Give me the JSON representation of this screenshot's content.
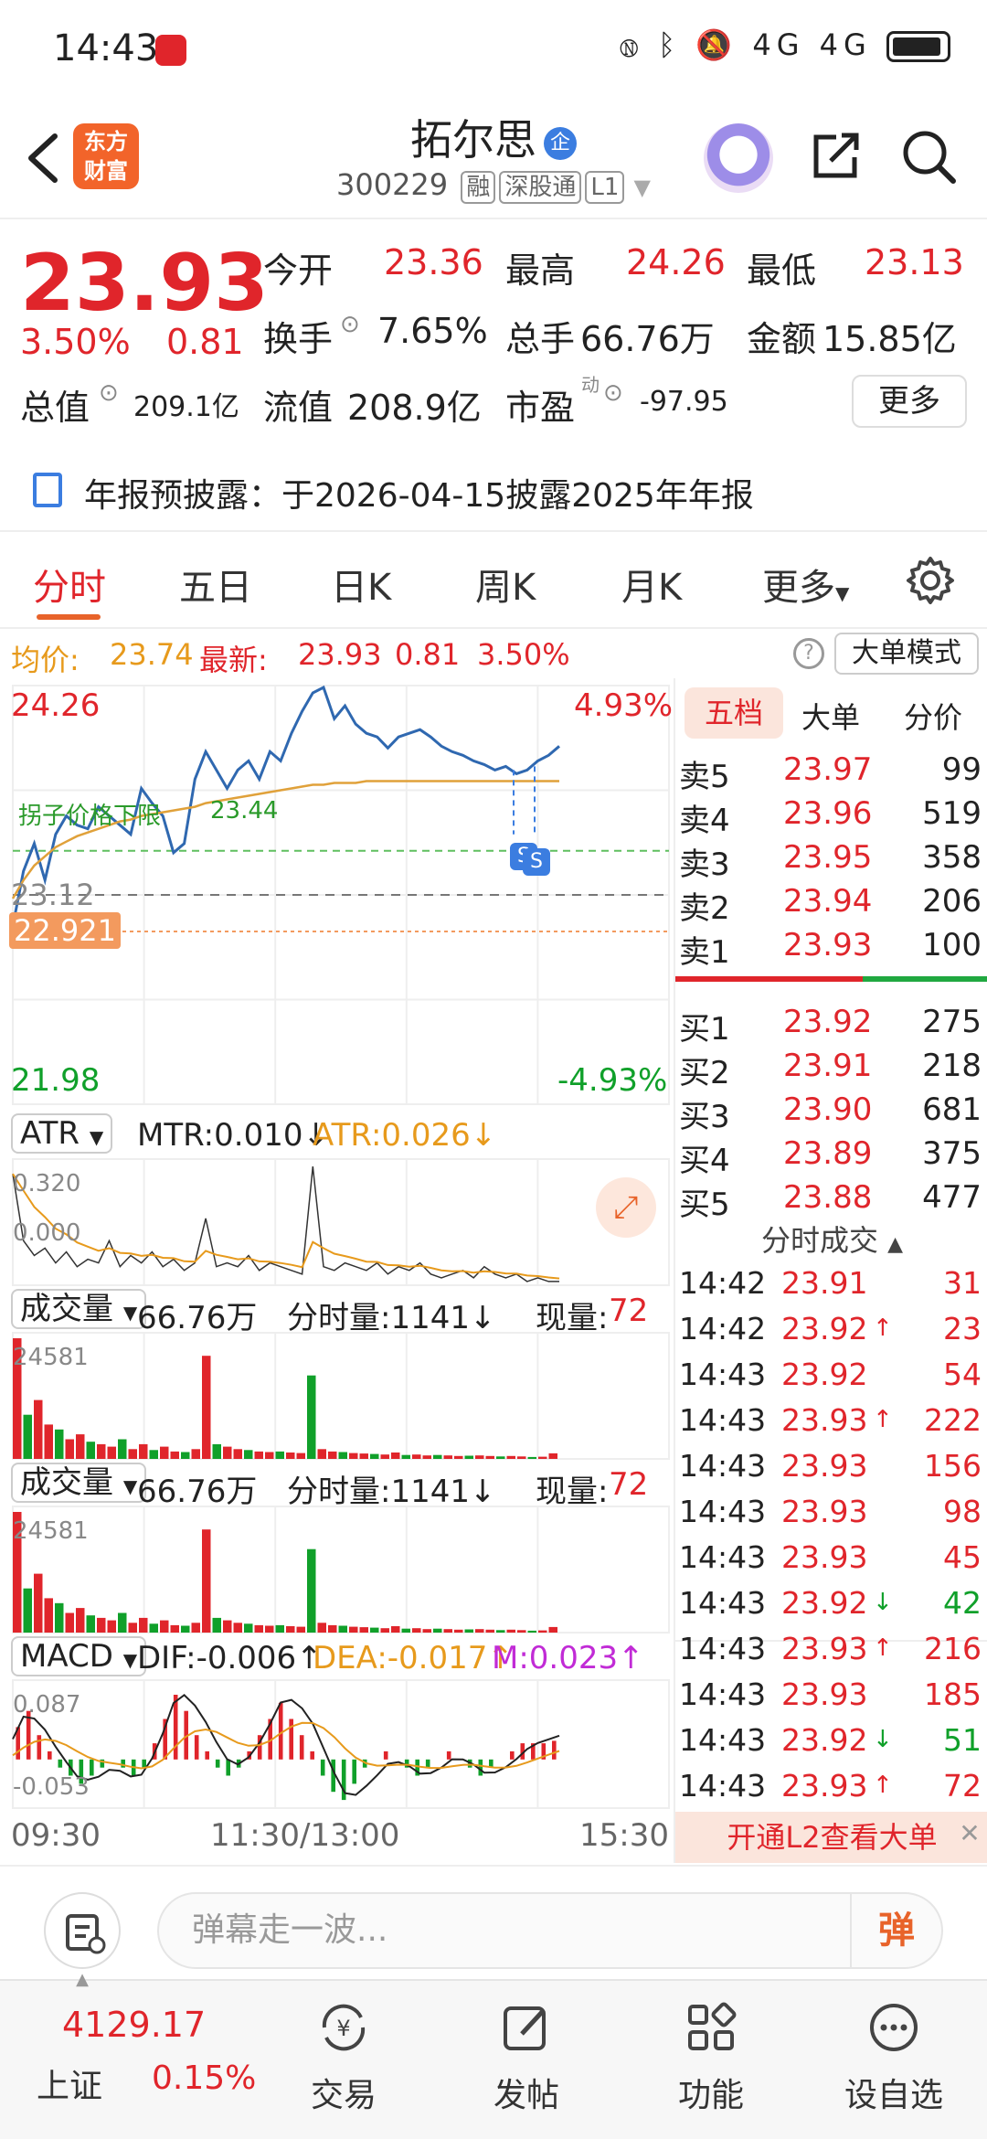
{
  "status_bar": {
    "time": "14:43",
    "network": "4G 4G"
  },
  "header": {
    "logo_line1": "东方",
    "logo_line2": "财富",
    "stock_name": "拓尔思",
    "name_badge": "企",
    "stock_code": "300229",
    "tags": [
      "融",
      "深股通",
      "L1"
    ]
  },
  "quote": {
    "price": "23.93",
    "change_pct": "3.50%",
    "change": "0.81",
    "open_label": "今开",
    "open": "23.36",
    "high_label": "最高",
    "high": "24.26",
    "low_label": "最低",
    "low": "23.13",
    "turnover_label": "换手",
    "turnover": "7.65%",
    "volume_label": "总手",
    "volume": "66.76万",
    "amount_label": "金额",
    "amount": "15.85亿",
    "mcap_label": "总值",
    "mcap": "209.1亿",
    "float_label": "流值",
    "float_mcap": "208.9亿",
    "pe_label": "市盈",
    "pe_sup": "动",
    "pe": "-97.95",
    "more_label": "更多"
  },
  "notice": {
    "text": "年报预披露：于2026-04-15披露2025年年报"
  },
  "tabs": [
    "分时",
    "五日",
    "日K",
    "周K",
    "月K",
    "更多"
  ],
  "info_line": {
    "avg_label": "均价:",
    "avg": "23.74",
    "latest_label": "最新:",
    "latest": "23.93",
    "change": "0.81",
    "change_pct": "3.50%",
    "help": "?",
    "big_order_mode": "大单模式"
  },
  "chart_data": [
    {
      "type": "line",
      "title": "分时",
      "x_ticks": [
        "09:30",
        "11:30/13:00",
        "15:30"
      ],
      "y_max": 24.26,
      "y_min": 21.98,
      "y_max_pct": "4.93%",
      "y_min_pct": "-4.93%",
      "prev_close": "23.12",
      "price_marker": "22.921",
      "limit_label": "拐子价格下限",
      "limit_value": "23.44",
      "series": [
        {
          "name": "价格",
          "color": "#2f68b0",
          "values": [
            22.95,
            23.25,
            23.4,
            23.2,
            23.45,
            23.55,
            23.5,
            23.48,
            23.6,
            23.55,
            23.5,
            23.45,
            23.7,
            23.62,
            23.55,
            23.35,
            23.4,
            23.75,
            23.9,
            23.8,
            23.7,
            23.8,
            23.85,
            23.75,
            23.9,
            23.85,
            24.0,
            24.12,
            24.22,
            24.25,
            24.08,
            24.15,
            24.05,
            24.0,
            23.98,
            23.92,
            23.98,
            24.0,
            24.02,
            23.98,
            23.93,
            23.9,
            23.88,
            23.85,
            23.83,
            23.8,
            23.82,
            23.78,
            23.8,
            23.85,
            23.88,
            23.93
          ]
        },
        {
          "name": "均价",
          "color": "#e0a13a",
          "values": [
            23.1,
            23.2,
            23.28,
            23.33,
            23.38,
            23.41,
            23.44,
            23.46,
            23.48,
            23.5,
            23.52,
            23.53,
            23.55,
            23.56,
            23.57,
            23.58,
            23.59,
            23.6,
            23.62,
            23.63,
            23.64,
            23.65,
            23.66,
            23.67,
            23.68,
            23.69,
            23.7,
            23.71,
            23.72,
            23.72,
            23.73,
            23.73,
            23.73,
            23.74,
            23.74,
            23.74,
            23.74,
            23.74,
            23.74,
            23.74,
            23.74,
            23.74,
            23.74,
            23.74,
            23.74,
            23.74,
            23.74,
            23.74,
            23.74,
            23.74,
            23.74,
            23.74
          ]
        }
      ]
    },
    {
      "type": "line",
      "title": "ATR",
      "labels": {
        "selector": "ATR",
        "mtr": "MTR:0.010↓",
        "atr": "ATR:0.026↓",
        "top": "0.320",
        "bottom": "0.000"
      },
      "values": [
        0.3,
        0.12,
        0.08,
        0.1,
        0.06,
        0.09,
        0.05,
        0.07,
        0.06,
        0.12,
        0.05,
        0.08,
        0.06,
        0.09,
        0.05,
        0.07,
        0.04,
        0.06,
        0.18,
        0.05,
        0.06,
        0.05,
        0.08,
        0.04,
        0.06,
        0.05,
        0.04,
        0.03,
        0.32,
        0.05,
        0.04,
        0.06,
        0.05,
        0.04,
        0.06,
        0.03,
        0.05,
        0.04,
        0.06,
        0.03,
        0.02,
        0.03,
        0.04,
        0.02,
        0.05,
        0.03,
        0.02,
        0.03,
        0.01,
        0.02,
        0.01,
        0.01
      ]
    },
    {
      "type": "bar",
      "title": "成交量",
      "labels": {
        "selector": "成交量",
        "total": "66.76万",
        "minute": "分时量:1141↓",
        "now_label": "现量:",
        "now": "72",
        "top": "24581"
      },
      "values": [
        24581,
        9000,
        12000,
        7000,
        6000,
        4000,
        5000,
        3500,
        3000,
        2500,
        4000,
        2000,
        3000,
        1800,
        2500,
        1500,
        1400,
        2000,
        21000,
        3000,
        2500,
        2000,
        1800,
        1500,
        1400,
        1500,
        1300,
        1200,
        17000,
        2000,
        1500,
        1400,
        1200,
        1100,
        1000,
        900,
        1300,
        800,
        900,
        700,
        800,
        700,
        600,
        650,
        700,
        600,
        500,
        600,
        500,
        400,
        450,
        1141
      ]
    },
    {
      "type": "bar",
      "title": "成交量2",
      "labels": {
        "selector": "成交量",
        "total": "66.76万",
        "minute": "分时量:1141↓",
        "now_label": "现量:",
        "now": "72",
        "top": "24581"
      },
      "values": [
        24581,
        9000,
        12000,
        7000,
        6000,
        4000,
        5000,
        3500,
        3000,
        2500,
        4000,
        2000,
        3000,
        1800,
        2500,
        1500,
        1400,
        2000,
        21000,
        3000,
        2500,
        2000,
        1800,
        1500,
        1400,
        1500,
        1300,
        1200,
        17000,
        2000,
        1500,
        1400,
        1200,
        1100,
        1000,
        900,
        1300,
        800,
        900,
        700,
        800,
        700,
        600,
        650,
        700,
        600,
        500,
        600,
        500,
        400,
        450,
        1141
      ]
    },
    {
      "type": "bar",
      "title": "MACD",
      "labels": {
        "selector": "MACD",
        "dif": "DIF:-0.006↑",
        "dea": "DEA:-0.017↑",
        "m": "M:0.023↑",
        "top": "0.087",
        "bottom": "-0.053"
      },
      "values": [
        0.04,
        0.06,
        0.03,
        0.01,
        -0.01,
        -0.02,
        -0.03,
        -0.02,
        -0.01,
        0.0,
        -0.01,
        -0.02,
        -0.01,
        0.02,
        0.05,
        0.08,
        0.06,
        0.03,
        0.01,
        -0.01,
        -0.02,
        -0.01,
        0.01,
        0.03,
        0.05,
        0.07,
        0.05,
        0.03,
        0.01,
        -0.02,
        -0.04,
        -0.05,
        -0.03,
        -0.01,
        0.0,
        0.01,
        0.0,
        -0.01,
        -0.02,
        -0.01,
        0.0,
        0.01,
        0.0,
        -0.01,
        -0.02,
        -0.01,
        0.0,
        0.01,
        0.02,
        0.02,
        0.02,
        0.023
      ]
    }
  ],
  "panel": {
    "tabs": [
      "五档",
      "大单",
      "分价"
    ],
    "asks": [
      {
        "label": "卖5",
        "price": "23.97",
        "vol": "99"
      },
      {
        "label": "卖4",
        "price": "23.96",
        "vol": "519"
      },
      {
        "label": "卖3",
        "price": "23.95",
        "vol": "358"
      },
      {
        "label": "卖2",
        "price": "23.94",
        "vol": "206"
      },
      {
        "label": "卖1",
        "price": "23.93",
        "vol": "100"
      }
    ],
    "bids": [
      {
        "label": "买1",
        "price": "23.92",
        "vol": "275"
      },
      {
        "label": "买2",
        "price": "23.91",
        "vol": "218"
      },
      {
        "label": "买3",
        "price": "23.90",
        "vol": "681"
      },
      {
        "label": "买4",
        "price": "23.89",
        "vol": "375"
      },
      {
        "label": "买5",
        "price": "23.88",
        "vol": "477"
      }
    ],
    "trades_title": "分时成交",
    "trades": [
      {
        "time": "14:42",
        "price": "23.91",
        "arrow": "",
        "vol": "31",
        "dir": "red"
      },
      {
        "time": "14:42",
        "price": "23.92",
        "arrow": "↑",
        "vol": "23",
        "dir": "red"
      },
      {
        "time": "14:43",
        "price": "23.92",
        "arrow": "",
        "vol": "54",
        "dir": "red"
      },
      {
        "time": "14:43",
        "price": "23.93",
        "arrow": "↑",
        "vol": "222",
        "dir": "red"
      },
      {
        "time": "14:43",
        "price": "23.93",
        "arrow": "",
        "vol": "156",
        "dir": "red"
      },
      {
        "time": "14:43",
        "price": "23.93",
        "arrow": "",
        "vol": "98",
        "dir": "red"
      },
      {
        "time": "14:43",
        "price": "23.93",
        "arrow": "",
        "vol": "45",
        "dir": "red"
      },
      {
        "time": "14:43",
        "price": "23.92",
        "arrow": "↓",
        "vol": "42",
        "dir": "green"
      },
      {
        "time": "14:43",
        "price": "23.93",
        "arrow": "↑",
        "vol": "216",
        "dir": "red"
      },
      {
        "time": "14:43",
        "price": "23.93",
        "arrow": "",
        "vol": "185",
        "dir": "red"
      },
      {
        "time": "14:43",
        "price": "23.92",
        "arrow": "↓",
        "vol": "51",
        "dir": "green"
      },
      {
        "time": "14:43",
        "price": "23.93",
        "arrow": "↑",
        "vol": "72",
        "dir": "red"
      }
    ],
    "l2_text": "开通L2查看大单"
  },
  "comment": {
    "placeholder": "弹幕走一波...",
    "danmu_label": "弹"
  },
  "bottom_nav": {
    "index_value": "4129.17",
    "index_name": "上证",
    "index_pct": "0.15%",
    "items": [
      "交易",
      "发帖",
      "功能",
      "设自选"
    ]
  },
  "colors": {
    "up": "#e0252b",
    "down": "#10a02a",
    "accent": "#e8632a",
    "price_line": "#2f68b0",
    "avg_line": "#e0a13a"
  }
}
